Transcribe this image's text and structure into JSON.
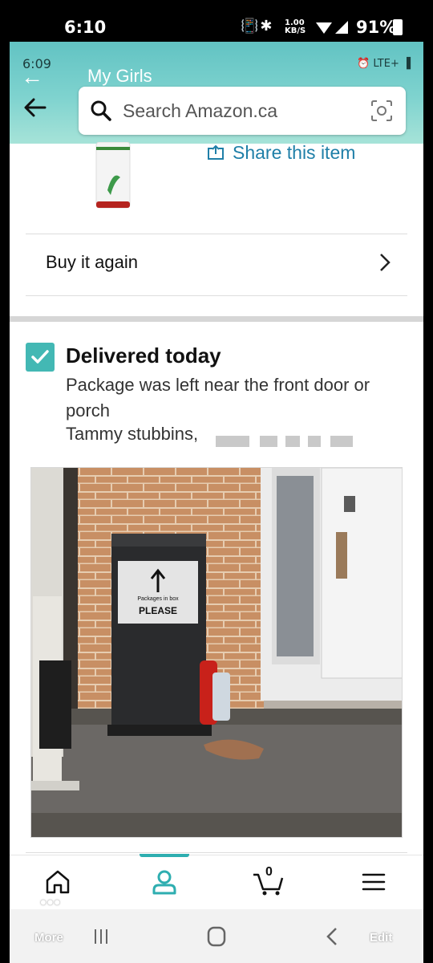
{
  "outer_status": {
    "time": "6:10",
    "net_speed_value": "1.00",
    "net_speed_unit": "KB/S",
    "battery": "91%"
  },
  "inner_status": {
    "time": "6:09",
    "right_text": "LTE+"
  },
  "overlay": {
    "title": "My Girls"
  },
  "search": {
    "placeholder": "Search Amazon.ca"
  },
  "product": {
    "share_label": "Share this item"
  },
  "buy_again": {
    "label": "Buy it again"
  },
  "delivery": {
    "status": "Delivered today",
    "description": "Package was left near the front door or porch",
    "recipient": "Tammy stubbins,"
  },
  "photo": {
    "sign_line1": "Packages in box",
    "sign_line2": "PLEASE"
  },
  "bottom_nav": {
    "cart_count": "0",
    "active_tab": "account"
  },
  "overlay_buttons": {
    "more": "More",
    "edit": "Edit"
  },
  "colors": {
    "header_teal": "#62c3c3",
    "accent_teal": "#43b8b4",
    "link_blue": "#1f7fa8",
    "nav_active": "#2eaeb0"
  }
}
